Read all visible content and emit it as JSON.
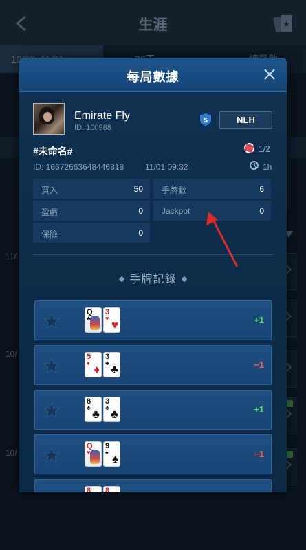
{
  "background": {
    "title": "生涯",
    "tabs": [
      "10/22–11/01",
      "30天",
      "總局數"
    ],
    "dates": [
      "11/",
      "10/",
      "10/"
    ]
  },
  "modal": {
    "title": "每局數據",
    "user": {
      "name": "Emirate Fly",
      "id": "ID: 100988"
    },
    "game_type": "NLH",
    "game": {
      "name": "#未命名#",
      "players": "1/2",
      "id": "ID: 16672663648446818",
      "time": "11/01 09:32",
      "duration": "1h"
    },
    "stats": {
      "buyin_label": "買入",
      "buyin_value": "50",
      "hands_label": "手牌數",
      "hands_value": "6",
      "profit_label": "盈虧",
      "profit_value": "0",
      "jackpot_label": "Jackpot",
      "jackpot_value": "0",
      "insurance_label": "保險",
      "insurance_value": "0"
    },
    "section_title": "手牌記錄",
    "hands": [
      {
        "cards": [
          {
            "rank": "Q",
            "suit": "♣",
            "color": "black",
            "face": true
          },
          {
            "rank": "3",
            "suit": "♥",
            "color": "red",
            "face": false
          }
        ],
        "result": "+1",
        "outcome": "win"
      },
      {
        "cards": [
          {
            "rank": "5",
            "suit": "♦",
            "color": "red",
            "face": false
          },
          {
            "rank": "3",
            "suit": "♣",
            "color": "black",
            "face": false
          }
        ],
        "result": "−1",
        "outcome": "loss"
      },
      {
        "cards": [
          {
            "rank": "8",
            "suit": "♣",
            "color": "black",
            "face": false
          },
          {
            "rank": "3",
            "suit": "♣",
            "color": "black",
            "face": false
          }
        ],
        "result": "+1",
        "outcome": "win"
      },
      {
        "cards": [
          {
            "rank": "Q",
            "suit": "♥",
            "color": "red",
            "face": true
          },
          {
            "rank": "9",
            "suit": "♠",
            "color": "black",
            "face": false
          }
        ],
        "result": "−1",
        "outcome": "loss"
      },
      {
        "cards": [
          {
            "rank": "8",
            "suit": "♥",
            "color": "red",
            "face": false
          },
          {
            "rank": "8",
            "suit": "♥",
            "color": "red",
            "face": false
          }
        ],
        "result": "",
        "outcome": "win"
      }
    ]
  },
  "colors": {
    "accent": "#1d5488",
    "win": "#57e06a",
    "loss": "#ff5a4a",
    "annotation": "#e02a2a"
  },
  "icons": {
    "back": "back-arrow-icon",
    "cards": "cards-icon",
    "close": "close-icon",
    "shield": "shield-dollar-icon",
    "star": "star-icon",
    "clock": "clock-icon",
    "chip": "chip-icon"
  }
}
